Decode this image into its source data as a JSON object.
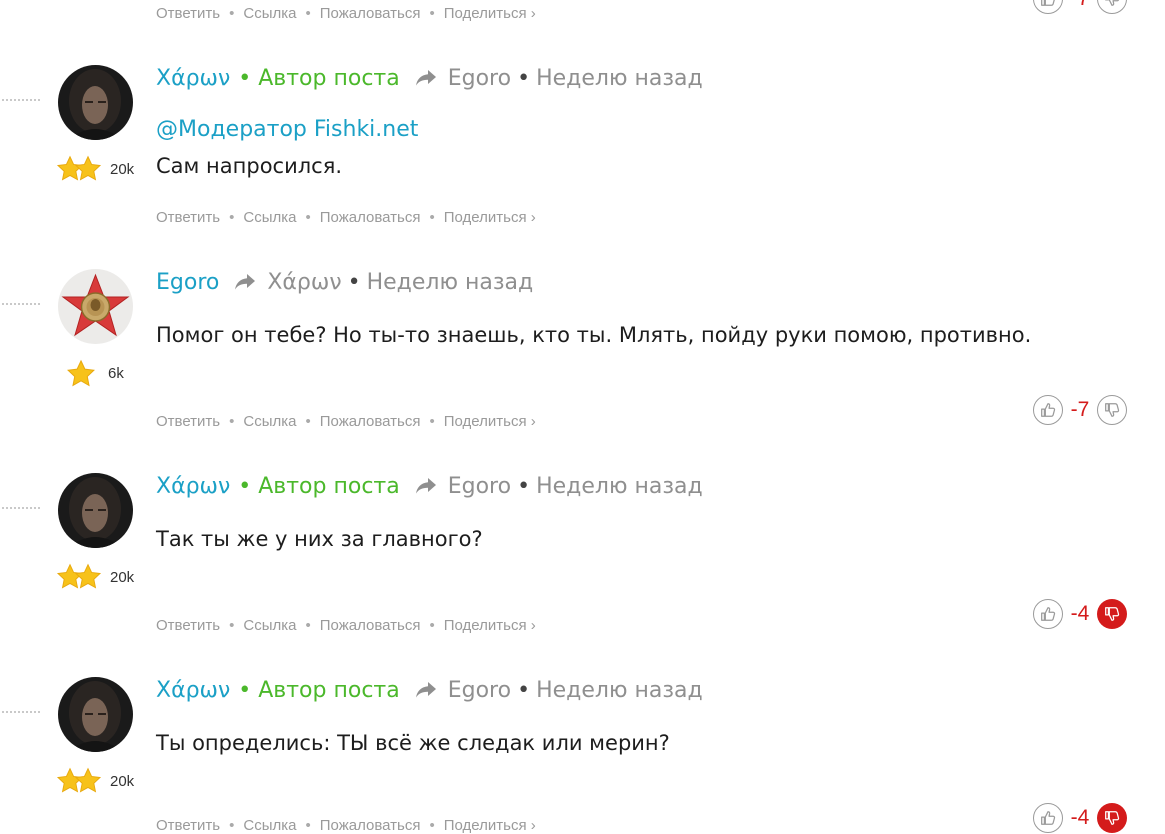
{
  "action_labels": {
    "reply": "Ответить",
    "link": "Ссылка",
    "report": "Пожаловаться",
    "share": "Поделиться ›"
  },
  "top_partial": {
    "score": "-7"
  },
  "comments": [
    {
      "author": "Χάρων",
      "badge": "• Автор поста",
      "reply_to": "Egoro",
      "time": "Неделю назад",
      "mention": "@Модератор Fishki.net",
      "text": "Сам напросился.",
      "rating": "20k",
      "stars": 2
    },
    {
      "author": "Egoro",
      "reply_to": "Χάρων",
      "time": "Неделю назад",
      "text": "Помог он тебе? Но ты-то знаешь, кто ты. Млять, пойду руки помою, противно.",
      "rating": "6k",
      "stars": 1,
      "score": "-7",
      "downvoted": false
    },
    {
      "author": "Χάρων",
      "badge": "• Автор поста",
      "reply_to": "Egoro",
      "time": "Неделю назад",
      "text": "Так ты же у них за главного?",
      "rating": "20k",
      "stars": 2,
      "score": "-4",
      "downvoted": true
    },
    {
      "author": "Χάρων",
      "badge": "• Автор поста",
      "reply_to": "Egoro",
      "time": "Неделю назад",
      "text": "Ты определись: ТЫ всё же следак или мерин?",
      "rating": "20k",
      "stars": 2,
      "score": "-4",
      "downvoted": true
    }
  ],
  "colors": {
    "author": "#1ba0c6",
    "badge": "#4bb82b",
    "muted": "#8f8f8f",
    "score": "#d41b1b"
  }
}
